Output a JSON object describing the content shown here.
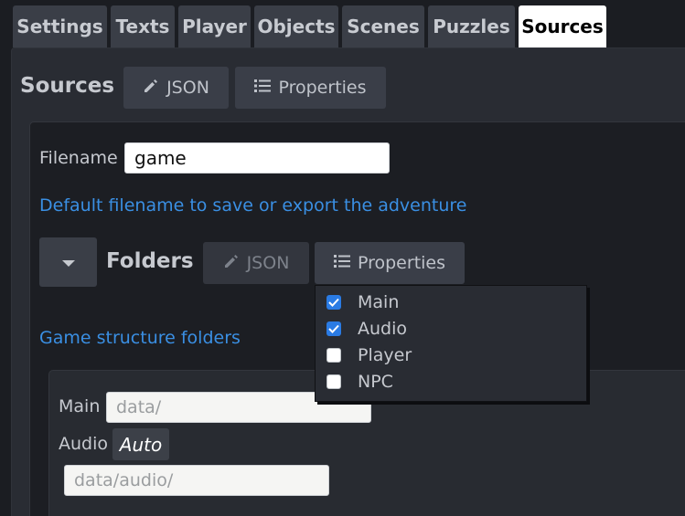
{
  "tabs": [
    {
      "label": "Settings",
      "active": false
    },
    {
      "label": "Texts",
      "active": false
    },
    {
      "label": "Player",
      "active": false
    },
    {
      "label": "Objects",
      "active": false
    },
    {
      "label": "Scenes",
      "active": false
    },
    {
      "label": "Puzzles",
      "active": false
    },
    {
      "label": "Sources",
      "active": true
    }
  ],
  "sources": {
    "title": "Sources",
    "json_label": "JSON",
    "properties_label": "Properties"
  },
  "filename": {
    "label": "Filename",
    "value": "game",
    "help": "Default filename to save or export the adventure"
  },
  "folders": {
    "title": "Folders",
    "json_label": "JSON",
    "properties_label": "Properties",
    "help": "Game structure folders",
    "main_label": "Main",
    "main_placeholder": "data/",
    "audio_label": "Audio",
    "audio_badge": "Auto",
    "audio_placeholder": "data/audio/"
  },
  "properties_menu": [
    {
      "label": "Main",
      "checked": true
    },
    {
      "label": "Audio",
      "checked": true
    },
    {
      "label": "Player",
      "checked": false
    },
    {
      "label": "NPC",
      "checked": false
    }
  ],
  "colors": {
    "background": "#1b1d22",
    "tab_active": "#ffffff",
    "link": "#3a8fe3",
    "checkbox_checked": "#2a7be4"
  }
}
